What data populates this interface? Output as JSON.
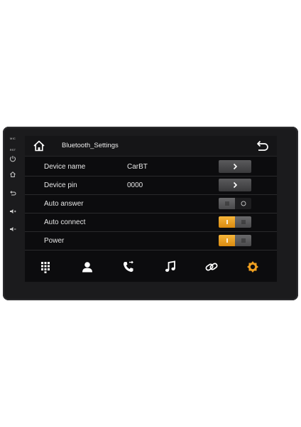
{
  "sidekeys": {
    "mic": "MIC",
    "rst": "RST"
  },
  "header": {
    "title": "Bluetooth_Settings"
  },
  "rows": [
    {
      "label": "Device name",
      "value": "CarBT",
      "control": "arrow"
    },
    {
      "label": "Device pin",
      "value": "0000",
      "control": "arrow"
    },
    {
      "label": "Auto answer",
      "value": "",
      "control": "toggle",
      "state": "off"
    },
    {
      "label": "Auto connect",
      "value": "",
      "control": "toggle",
      "state": "on"
    },
    {
      "label": "Power",
      "value": "",
      "control": "toggle",
      "state": "on"
    }
  ],
  "bottom_nav": [
    "dialpad-icon",
    "contacts-icon",
    "call-log-icon",
    "music-icon",
    "link-icon",
    "settings-icon"
  ],
  "colors": {
    "accent": "#f0a020",
    "bezel": "#1b1b1d",
    "screen": "#0c0c0e"
  }
}
